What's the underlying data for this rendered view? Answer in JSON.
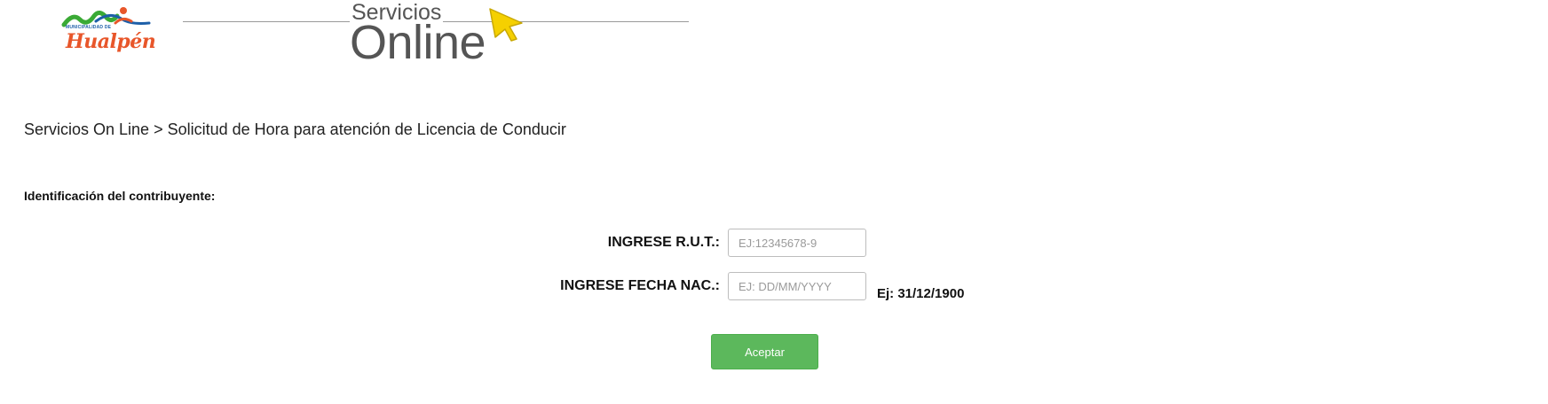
{
  "header": {
    "logo": {
      "icon": "municipality-logo",
      "small_text": "MUNICIPALIDAD DE",
      "name": "Hualpén"
    },
    "title_top": "Servicios",
    "title_bottom": "Online"
  },
  "breadcrumb": "Servicios On Line > Solicitud de Hora para atención de Licencia de Conducir",
  "section": {
    "label": "Identificación del contribuyente:"
  },
  "form": {
    "rut_label": "INGRESE R.U.T.:",
    "rut_placeholder": "EJ:12345678-9",
    "rut_value": "",
    "birth_label": "INGRESE FECHA NAC.:",
    "birth_placeholder": "EJ: DD/MM/YYYY",
    "birth_value": "",
    "birth_hint": "Ej: 31/12/1900",
    "submit_label": "Aceptar"
  },
  "colors": {
    "button": "#5cb85c",
    "logo_orange": "#e8562a",
    "logo_green": "#3aaa35",
    "logo_blue": "#1d5fa8",
    "cursor": "#f5d000"
  }
}
